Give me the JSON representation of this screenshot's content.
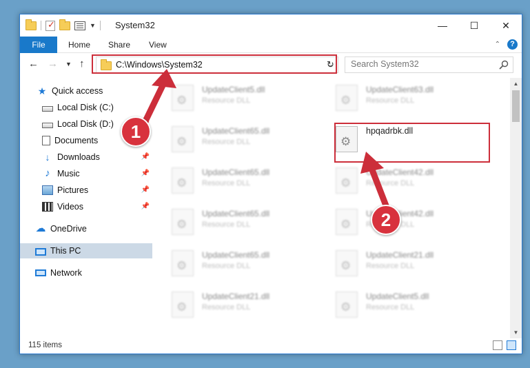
{
  "window": {
    "title": "System32",
    "controls": {
      "minimize": "—",
      "maximize": "☐",
      "close": "✕"
    }
  },
  "ribbon": {
    "tabs": [
      "File",
      "Home",
      "Share",
      "View"
    ]
  },
  "navigation": {
    "address": "C:\\Windows\\System32",
    "search_placeholder": "Search System32"
  },
  "sidebar": {
    "items": [
      {
        "label": "Quick access",
        "icon": "star-icon"
      },
      {
        "label": "Local Disk (C:)",
        "icon": "drive-icon"
      },
      {
        "label": "Local Disk (D:)",
        "icon": "drive-icon"
      },
      {
        "label": "Documents",
        "icon": "documents-icon"
      },
      {
        "label": "Downloads",
        "icon": "download-icon"
      },
      {
        "label": "Music",
        "icon": "music-icon"
      },
      {
        "label": "Pictures",
        "icon": "pictures-icon"
      },
      {
        "label": "Videos",
        "icon": "videos-icon"
      },
      {
        "label": "OneDrive",
        "icon": "cloud-icon"
      },
      {
        "label": "This PC",
        "icon": "computer-icon"
      },
      {
        "label": "Network",
        "icon": "network-icon"
      }
    ]
  },
  "files": {
    "left_column": [
      {
        "name": "UpdateClient5.dll",
        "type": "Resource DLL"
      },
      {
        "name": "UpdateClient65.dll",
        "type": "Resource DLL"
      },
      {
        "name": "UpdateClient65.dll",
        "type": "Resource DLL"
      },
      {
        "name": "UpdateClient65.dll",
        "type": "Resource DLL"
      },
      {
        "name": "UpdateClient65.dll",
        "type": "Resource DLL"
      },
      {
        "name": "UpdateClient21.dll",
        "type": "Resource DLL"
      }
    ],
    "right_column": [
      {
        "name": "UpdateClient63.dll",
        "type": "Resource DLL"
      },
      {
        "name": "hpqadrbk.dll",
        "type": ""
      },
      {
        "name": "UpdateClient42.dll",
        "type": "Resource DLL"
      },
      {
        "name": "UpdateClient42.dll",
        "type": "Resource DLL"
      },
      {
        "name": "UpdateClient21.dll",
        "type": "Resource DLL"
      },
      {
        "name": "UpdateClient5.dll",
        "type": "Resource DLL"
      }
    ]
  },
  "status": {
    "item_count": "115 items"
  },
  "annotations": {
    "step1": "1",
    "step2": "2",
    "color": "#cc2e3a"
  }
}
